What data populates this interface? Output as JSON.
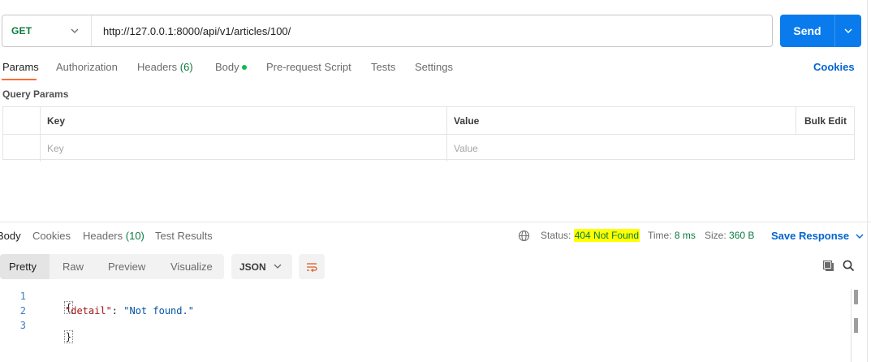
{
  "request": {
    "method": "GET",
    "url": "http://127.0.0.1:8000/api/v1/articles/100/",
    "send_label": "Send"
  },
  "request_tabs": {
    "params": "Params",
    "authorization": "Authorization",
    "headers": "Headers",
    "headers_count": "(6)",
    "body": "Body",
    "pre_request": "Pre-request Script",
    "tests": "Tests",
    "settings": "Settings",
    "cookies": "Cookies"
  },
  "query_params": {
    "title": "Query Params",
    "columns": {
      "key": "Key",
      "value": "Value",
      "bulk_edit": "Bulk Edit"
    },
    "placeholders": {
      "key": "Key",
      "value": "Value"
    }
  },
  "response_tabs": {
    "body": "Body",
    "cookies": "Cookies",
    "headers": "Headers",
    "headers_count": "(10)",
    "test_results": "Test Results"
  },
  "response_status": {
    "status_label": "Status:",
    "status_value": "404 Not Found",
    "time_label": "Time:",
    "time_value": "8 ms",
    "size_label": "Size:",
    "size_value": "360 B",
    "save_response": "Save Response"
  },
  "response_view": {
    "modes": [
      "Pretty",
      "Raw",
      "Preview",
      "Visualize"
    ],
    "active_mode": "Pretty",
    "format": "JSON"
  },
  "response_body": {
    "line_numbers": [
      "1",
      "2",
      "3"
    ],
    "open_brace": "{",
    "key": "\"detail\"",
    "colon": ": ",
    "value": "\"Not found.\"",
    "close_brace": "}"
  },
  "colors": {
    "accent_orange": "#ff6c37",
    "send_blue": "#097bed",
    "link_blue": "#0265d2",
    "method_green": "#0b7a3f",
    "status_highlight": "#ffff00"
  }
}
